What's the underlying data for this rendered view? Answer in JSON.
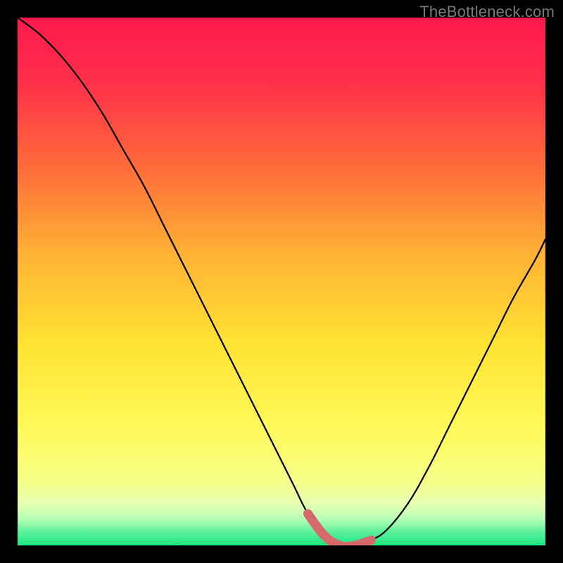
{
  "watermark": "TheBottleneck.com",
  "colors": {
    "background": "#000000",
    "curve_main": "#000000",
    "highlight": "#d66a6a",
    "gradient_stops": [
      {
        "offset": 0.0,
        "color": "#ff1a4d"
      },
      {
        "offset": 0.12,
        "color": "#ff2e4a"
      },
      {
        "offset": 0.28,
        "color": "#ff6a3a"
      },
      {
        "offset": 0.45,
        "color": "#ffb233"
      },
      {
        "offset": 0.62,
        "color": "#ffe333"
      },
      {
        "offset": 0.78,
        "color": "#fff95a"
      },
      {
        "offset": 0.88,
        "color": "#f6ff8a"
      },
      {
        "offset": 0.92,
        "color": "#e8ffb0"
      },
      {
        "offset": 0.95,
        "color": "#b6ffb6"
      },
      {
        "offset": 0.975,
        "color": "#5af09a"
      },
      {
        "offset": 1.0,
        "color": "#18e880"
      }
    ]
  },
  "chart_data": {
    "type": "line",
    "title": "",
    "xlabel": "",
    "ylabel": "",
    "xlim": [
      0,
      100
    ],
    "ylim": [
      0,
      100
    ],
    "grid": false,
    "legend": false,
    "series": [
      {
        "name": "bottleneck_curve",
        "x": [
          0,
          4,
          8,
          12,
          16,
          20,
          24,
          28,
          32,
          36,
          40,
          44,
          48,
          52,
          55,
          58,
          61,
          64,
          67,
          70,
          74,
          78,
          82,
          86,
          90,
          94,
          98,
          100
        ],
        "y": [
          100,
          97,
          93,
          88,
          82,
          75,
          68,
          60,
          52,
          44,
          36,
          28,
          20,
          12,
          6,
          2,
          0,
          0,
          1,
          3,
          8,
          15,
          23,
          31,
          39,
          47,
          54,
          58
        ]
      }
    ],
    "highlight_range_x": [
      55,
      68
    ],
    "annotations": []
  }
}
